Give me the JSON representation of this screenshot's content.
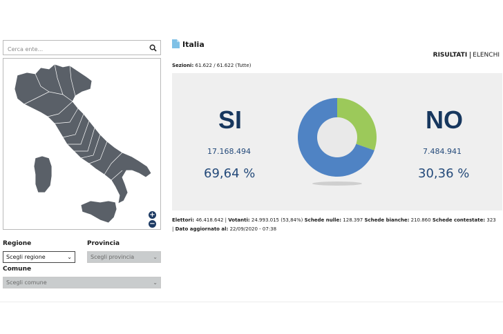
{
  "search": {
    "placeholder": "Cerca ente..."
  },
  "filters": {
    "region_label": "Regione",
    "region_value": "Scegli regione",
    "province_label": "Provincia",
    "province_value": "Scegli provincia",
    "comune_label": "Comune",
    "comune_value": "Scegli comune"
  },
  "header": {
    "title": "Italia",
    "tab_results": "RISULTATI",
    "tab_lists": "ELENCHI"
  },
  "sections": {
    "label": "Sezioni:",
    "value": "61.622 / 61.622 (Tutte)"
  },
  "results": {
    "yes_label": "SI",
    "yes_votes": "17.168.494",
    "yes_pct": "69,64 %",
    "no_label": "NO",
    "no_votes": "7.484.941",
    "no_pct": "30,36 %",
    "yes_fraction": 0.6964,
    "yes_color": "#4f83c4",
    "no_color": "#9cc95a"
  },
  "summary": {
    "elettori_label": "Elettori:",
    "elettori": "46.418.642",
    "votanti_label": "Votanti:",
    "votanti": "24.993.015 (53,84%)",
    "nulle_label": "Schede nulle:",
    "nulle": "128.397",
    "bianche_label": "Schede bianche:",
    "bianche": "210.860",
    "contestate_label": "Schede contestate:",
    "contestate": "323",
    "aggiornato_label": "Dato aggiornato al:",
    "aggiornato": "22/09/2020 - 07:38"
  },
  "icons": {
    "search": "search-icon",
    "zoom_in": "zoom-in-icon",
    "zoom_out": "zoom-out-icon",
    "title": "document-icon"
  }
}
